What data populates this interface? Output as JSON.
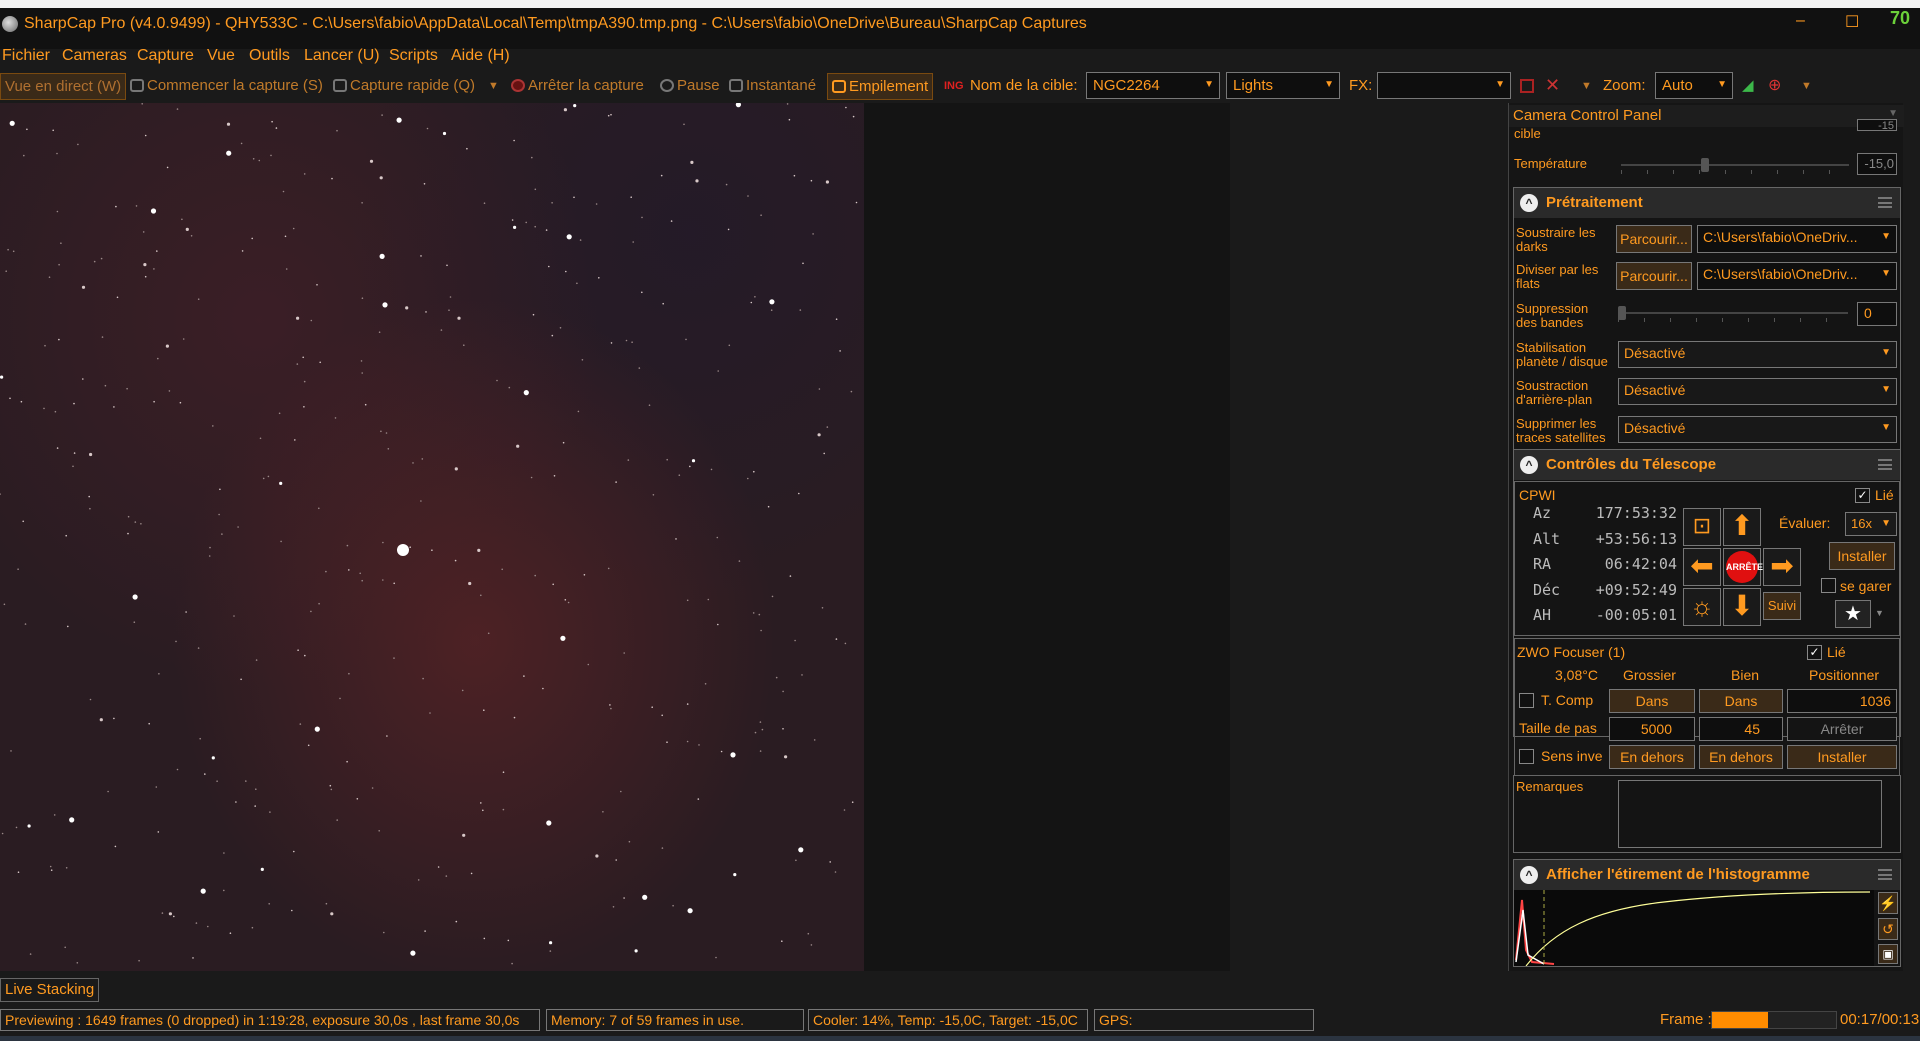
{
  "window": {
    "title": "SharpCap Pro (v4.0.9499) - QHY533C - C:\\Users\\fabio\\AppData\\Local\\Temp\\tmpA390.tmp.png - C:\\Users\\fabio\\OneDrive\\Bureau\\SharpCap Captures",
    "minimize": "–",
    "maximize": "☐",
    "close": "✕",
    "badge": "70"
  },
  "menu": [
    "Fichier",
    "Cameras",
    "Capture",
    "Vue",
    "Outils",
    "Lancer (U)",
    "Scripts",
    "Aide (H)"
  ],
  "toolbar": {
    "live_view": "Vue en direct (W)",
    "start_capture": "Commencer la capture (S)",
    "quick_capture": "Capture rapide (Q)",
    "stop_capture": "Arrêter la capture",
    "pause": "Pause",
    "snapshot": "Instantané",
    "stacking": "Empilement",
    "target_label": "Nom de la cible:",
    "target_value": "NGC2264",
    "frame_type": "Lights",
    "fx_label": "FX:",
    "fx_value": "",
    "zoom_label": "Zoom:",
    "zoom_value": "Auto"
  },
  "panel": {
    "header": "Camera Control Panel",
    "cible_label": "cible",
    "cible_value": "-15",
    "temperature_label": "Température",
    "temperature_value": "-15,0"
  },
  "pretraitement": {
    "title": "Prétraitement",
    "darks_label": "Soustraire les darks",
    "flats_label": "Diviser par les flats",
    "browse": "Parcourir...",
    "darks_path": "C:\\Users\\fabio\\OneDriv...",
    "flats_path": "C:\\Users\\fabio\\OneDriv...",
    "banding_label": "Suppression des bandes",
    "banding_value": "0",
    "stab_label": "Stabilisation planète / disque",
    "stab_value": "Désactivé",
    "bg_label": "Soustraction d'arrière-plan",
    "bg_value": "Désactivé",
    "sat_label": "Supprimer les traces satellites",
    "sat_value": "Désactivé"
  },
  "telescope": {
    "title": "Contrôles du Télescope",
    "mount": "CPWI",
    "linked": "Lié",
    "coords": [
      {
        "label": "Az",
        "value": "177:53:32"
      },
      {
        "label": "Alt",
        "value": "+53:56:13"
      },
      {
        "label": "RA",
        "value": "06:42:04"
      },
      {
        "label": "Déc",
        "value": "+09:52:49"
      },
      {
        "label": "AH",
        "value": "-00:05:01"
      }
    ],
    "stop": "ARRÊTE",
    "rate_label": "Évaluer:",
    "rate_value": "16x",
    "install": "Installer",
    "park": "se garer",
    "track": "Suivi"
  },
  "focuser": {
    "name": "ZWO Focuser (1)",
    "linked": "Lié",
    "temp": "3,08°C",
    "coarse": "Grossier",
    "fine": "Bien",
    "position_label": "Positionner",
    "tcomp": "T. Comp",
    "in": "Dans",
    "position_value": "1036",
    "step_label": "Taille de pas",
    "coarse_step": "5000",
    "fine_step": "45",
    "stop": "Arrêter",
    "reverse": "Sens inve",
    "out": "En dehors",
    "install": "Installer"
  },
  "remarks": {
    "label": "Remarques"
  },
  "histogram": {
    "title": "Afficher l'étirement de l'histogramme"
  },
  "live_stacking": "Live Stacking",
  "status": {
    "preview": "Previewing : 1649 frames (0 dropped) in 1:19:28, exposure 30,0s , last frame 30,0s",
    "memory": "Memory: 7 of 59 frames in use.",
    "cooler": "Cooler: 14%, Temp: -15,0C, Target: -15,0C",
    "gps": "GPS:",
    "frame_label": "Frame :",
    "frame_progress": 0.45,
    "time": "00:17/00:13"
  },
  "colors": {
    "accent": "#ff9a20",
    "background": "#1a1a1a",
    "stop": "#e01010"
  }
}
